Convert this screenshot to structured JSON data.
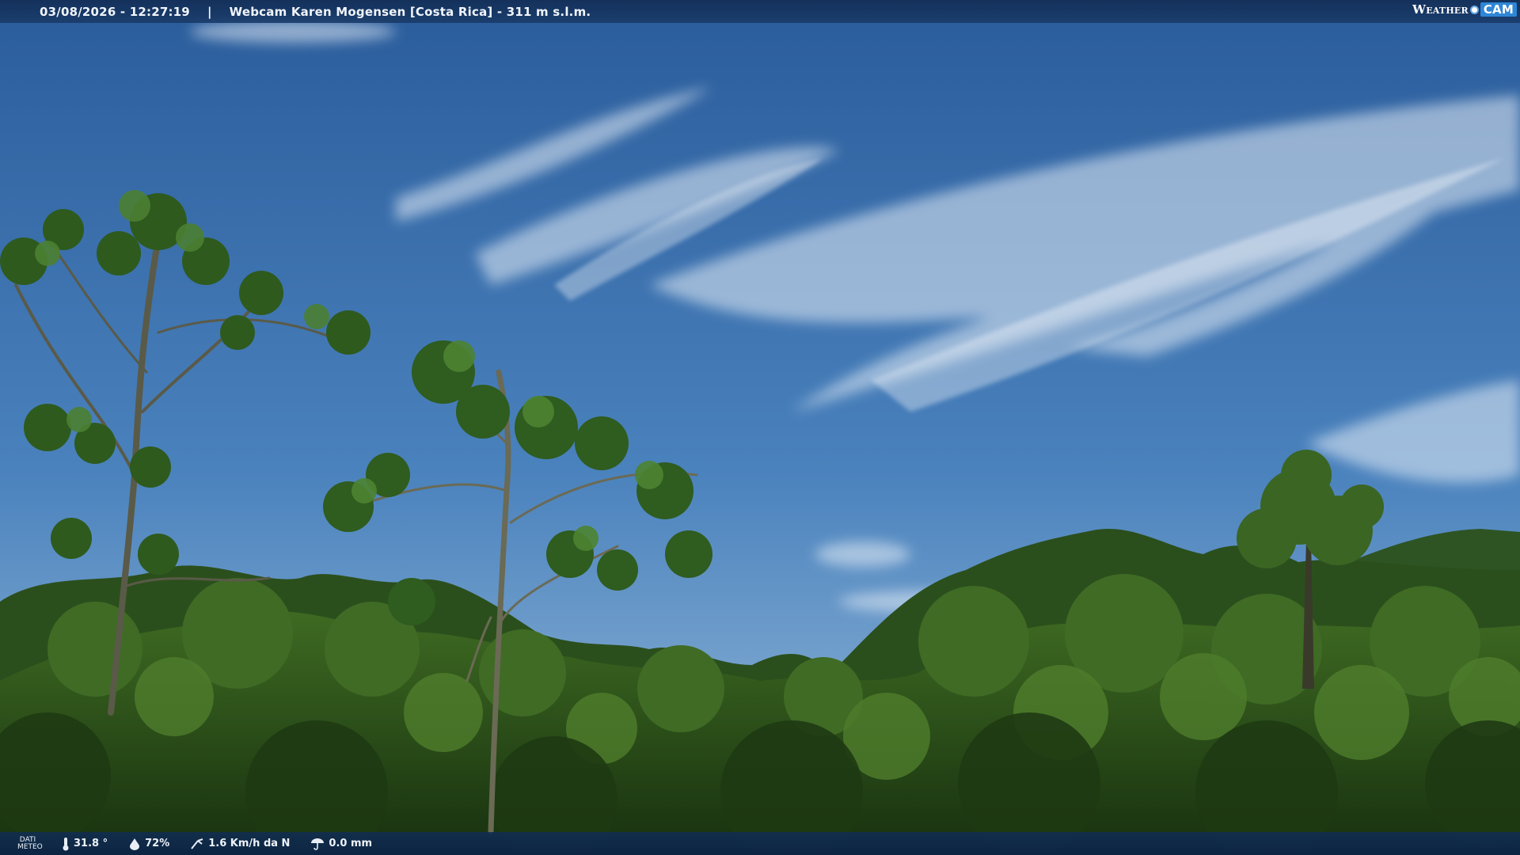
{
  "header": {
    "datetime": "03/08/2026 - 12:27:19",
    "separator": "|",
    "title": "Webcam Karen Mogensen [Costa Rica] - 311 m s.l.m.",
    "logo_word": "Weather",
    "logo_cam": "CAM"
  },
  "footer": {
    "dati_line1": "DATI",
    "dati_line2": "METEO",
    "temperature": "31.8 °",
    "humidity": "72%",
    "wind": "1.6 Km/h da N",
    "rain": "0.0 mm"
  },
  "colors": {
    "sky_top": "#2a5f9e",
    "sky_bottom": "#6a9ccc",
    "foliage_dark": "#1c3a14",
    "foliage_light": "#4f7a2c",
    "bar_bg": "#143a6a"
  },
  "icons": [
    "thermometer-icon",
    "humidity-icon",
    "wind-icon",
    "rain-icon"
  ]
}
